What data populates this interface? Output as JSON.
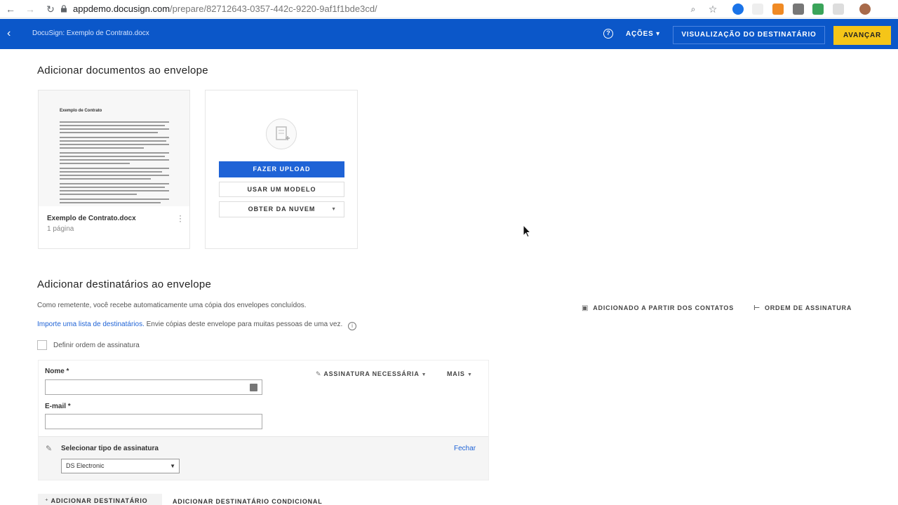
{
  "browser": {
    "url_host": "appdemo.docusign.com",
    "url_path": "/prepare/82712643-0357-442c-9220-9af1f1bde3cd/"
  },
  "header": {
    "doc_title": "DocuSign: Exemplo de Contrato.docx",
    "actions_label": "AÇÕES",
    "preview_label": "VISUALIZAÇÃO DO DESTINATÁRIO",
    "next_label": "AVANÇAR",
    "brand_color": "#0b57c9",
    "accent_color": "#f5c518"
  },
  "documents": {
    "section_title": "Adicionar documentos ao envelope",
    "items": [
      {
        "name": "Exemplo de Contrato.docx",
        "pages": "1 página",
        "thumb_title": "Exemplo de Contrato"
      }
    ],
    "upload": {
      "upload_label": "FAZER UPLOAD",
      "template_label": "USAR UM MODELO",
      "cloud_label": "OBTER DA NUVEM"
    }
  },
  "recipients": {
    "section_title": "Adicionar destinatários ao envelope",
    "sender_note": "Como remetente, você recebe automaticamente uma cópia dos envelopes concluídos.",
    "import_link": "Importe uma lista de destinatários.",
    "import_note": "Envie cópias deste envelope para muitas pessoas de uma vez.",
    "add_from_contacts": "ADICIONADO A PARTIR DOS CONTATOS",
    "signing_order": "ORDEM DE ASSINATURA",
    "set_order_label": "Definir ordem de assinatura",
    "card": {
      "name_label": "Nome *",
      "name_value": "",
      "email_label": "E-mail *",
      "email_value": "",
      "signature_required": "ASSINATURA NECESSÁRIA",
      "more": "MAIS",
      "sig_type_label": "Selecionar tipo de assinatura",
      "close_label": "Fechar",
      "sig_type_selected": "DS Electronic"
    },
    "add_recipient": "ADICIONAR DESTINATÁRIO",
    "add_conditional": "ADICIONAR DESTINATÁRIO CONDICIONAL"
  }
}
